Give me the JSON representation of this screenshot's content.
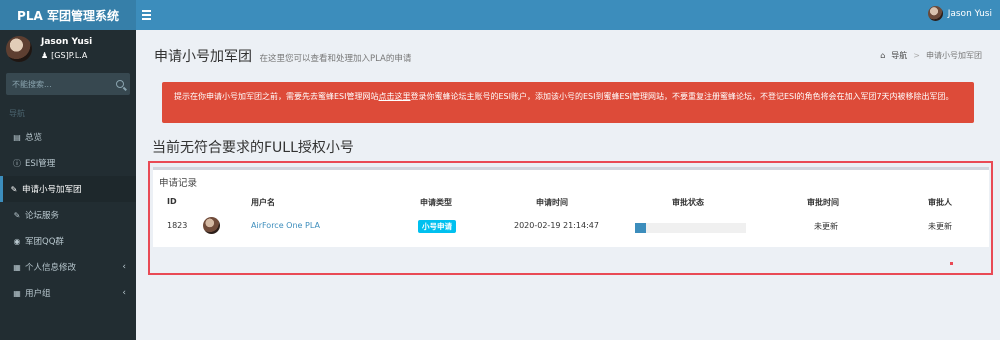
{
  "app": {
    "title": "PLA 军团管理系统"
  },
  "topbar": {
    "user_name": "Jason Yusi"
  },
  "sidebar": {
    "user": {
      "name": "Jason Yusi",
      "status": "[GS]P.L.A"
    },
    "search_placeholder": "不能搜索...",
    "header": "导航",
    "items": [
      {
        "label": "总览",
        "icon": "bar-chart-icon"
      },
      {
        "label": "ESI管理",
        "icon": "info-circle-icon"
      },
      {
        "label": "申请小号加军团",
        "icon": "pencil-icon",
        "active": true
      },
      {
        "label": "论坛服务",
        "icon": "comments-icon"
      },
      {
        "label": "军团QQ群",
        "icon": "qq-icon"
      },
      {
        "label": "个人信息修改",
        "icon": "th-icon",
        "has_submenu": true
      },
      {
        "label": "用户组",
        "icon": "th-list-icon",
        "has_submenu": true
      }
    ]
  },
  "header": {
    "title": "申请小号加军团",
    "subtitle": "在这里您可以查看和处理加入PLA的申请",
    "breadcrumb": {
      "home": "导航",
      "current": "申请小号加军团"
    }
  },
  "alert": {
    "text_before": "提示在你申请小号加军团之前，需要先去蜜蜂ESI管理网站",
    "link_text": "点击这里",
    "text_after": "登录你蜜蜂论坛主账号的ESI账户，添加该小号的ESI到蜜蜂ESI管理网站，不要重复注册蜜蜂论坛，不登记ESI的角色将会在加入军团7天内被移除出军团。"
  },
  "section_title": "当前无符合要求的FULL授权小号",
  "table": {
    "title": "申请记录",
    "columns": [
      "ID",
      "用户名",
      "申请类型",
      "申请时间",
      "审批状态",
      "审批时间",
      "审批人"
    ],
    "rows": [
      {
        "id": "1823",
        "username": "AirForce One PLA",
        "type": "小号申请",
        "time": "2020-02-19 21:14:47",
        "progress": 0.1,
        "approve_time": "未更新",
        "approver": "未更新"
      }
    ]
  },
  "colors": {
    "primary": "#3c8dbc",
    "danger": "#dd4b39",
    "info": "#00c0ef",
    "sidebar": "#222d32"
  }
}
